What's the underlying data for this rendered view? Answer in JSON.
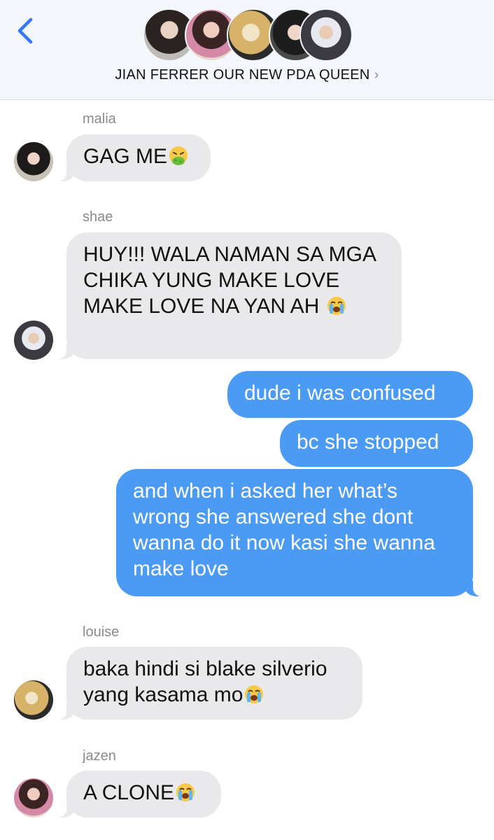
{
  "header": {
    "title": "JIAN FERRER OUR NEW PDA QUEEN",
    "chevron": "›",
    "participants": [
      "malia",
      "shae",
      "louise",
      "jazen",
      "member"
    ]
  },
  "messages": [
    {
      "sender": "malia",
      "text": "GAG ME",
      "emoji": "nauseated-face",
      "direction": "incoming"
    },
    {
      "sender": "shae",
      "text": "HUY!!! WALA NAMAN SA MGA CHIKA YUNG MAKE LOVE MAKE LOVE NA YAN AH",
      "emoji": "loudly-crying-face",
      "direction": "incoming"
    },
    {
      "text": "dude i was confused",
      "direction": "outgoing"
    },
    {
      "text": "bc she stopped",
      "direction": "outgoing"
    },
    {
      "text": "and when i asked her what’s wrong she answered she dont wanna do it now kasi she wanna make love",
      "direction": "outgoing"
    },
    {
      "sender": "louise",
      "text": "baka hindi si blake silverio yang kasama mo",
      "emoji": "loudly-crying-face",
      "direction": "incoming"
    },
    {
      "sender": "jazen",
      "text": "A CLONE",
      "emoji": "loudly-crying-face",
      "direction": "incoming"
    }
  ],
  "colors": {
    "outgoing_bubble": "#4b9bf4",
    "incoming_bubble": "#e9e9eb",
    "accent": "#3478f6",
    "header_bg": "#f3f7fb"
  }
}
